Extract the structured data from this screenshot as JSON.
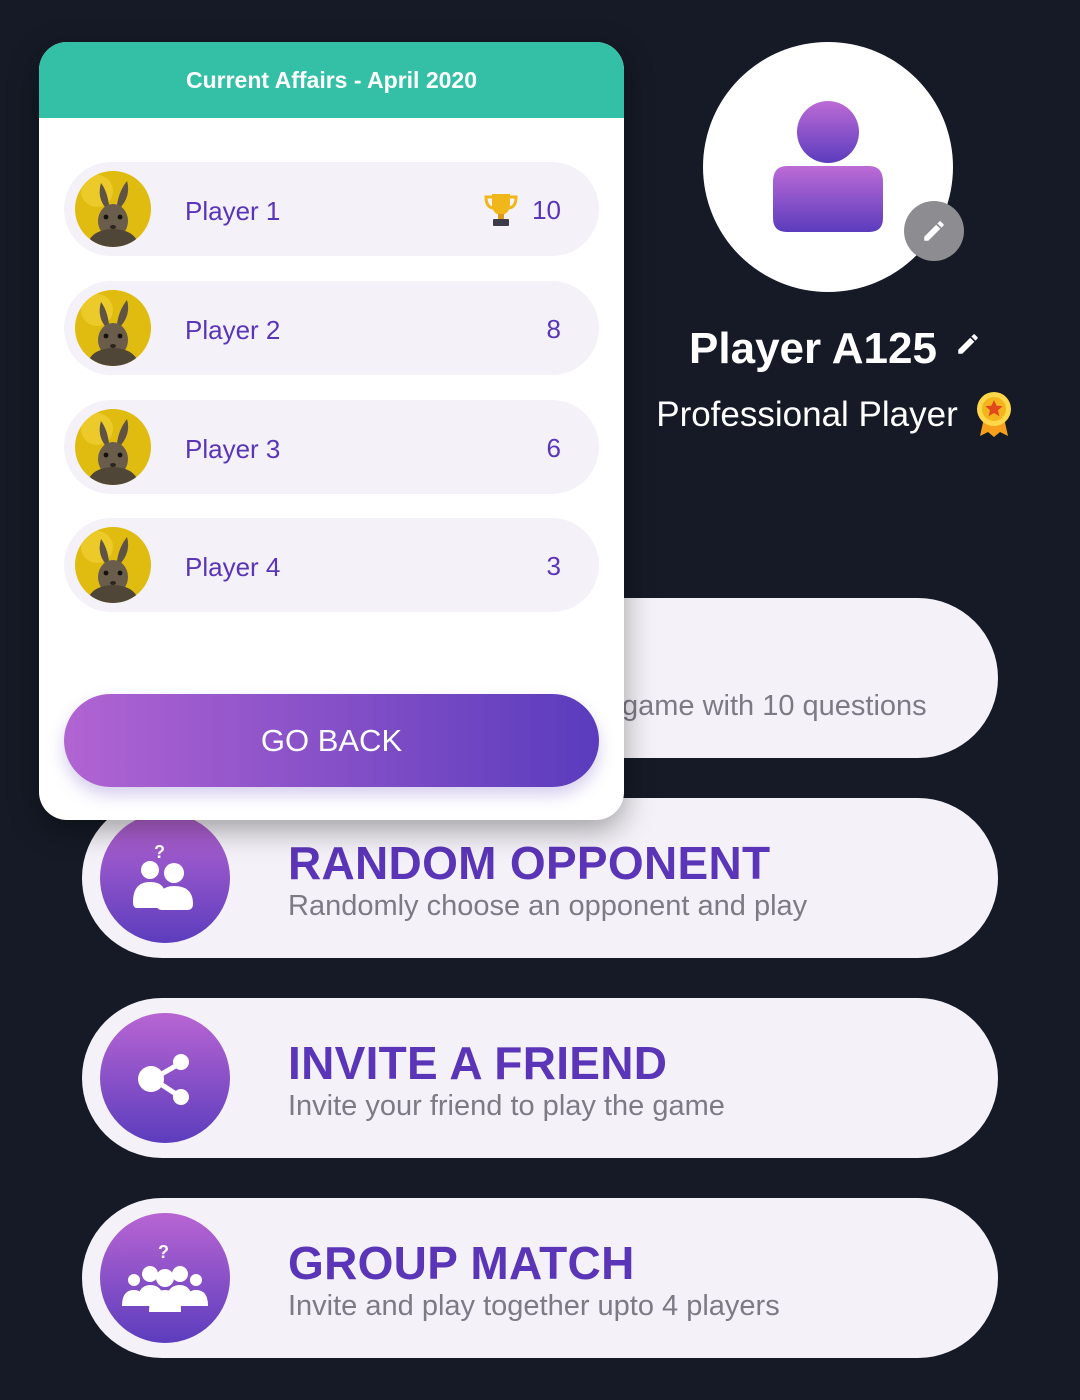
{
  "profile": {
    "name": "Player A125",
    "rank": "Professional Player"
  },
  "menu": [
    {
      "title": "",
      "subtitle": "game with 10 questions",
      "icon": "hidden-icon"
    },
    {
      "title": "RANDOM OPPONENT",
      "subtitle": "Randomly choose an opponent and play",
      "icon": "random-opponent-icon"
    },
    {
      "title": "INVITE A FRIEND",
      "subtitle": "Invite your friend to play the game",
      "icon": "share-icon"
    },
    {
      "title": "GROUP MATCH",
      "subtitle": "Invite and play together upto 4 players",
      "icon": "group-icon"
    }
  ],
  "leaderboard": {
    "title": "Current Affairs - April 2020",
    "players": [
      {
        "name": "Player 1",
        "score": "10",
        "trophy": true
      },
      {
        "name": "Player 2",
        "score": "8",
        "trophy": false
      },
      {
        "name": "Player 3",
        "score": "6",
        "trophy": false
      },
      {
        "name": "Player 4",
        "score": "3",
        "trophy": false
      }
    ],
    "go_back_label": "GO BACK"
  },
  "colors": {
    "background": "#151a26",
    "header": "#34bfa7",
    "accent_purple": "#5a35b8",
    "gradient_start": "#b865d3",
    "gradient_end": "#5c3dbd"
  }
}
